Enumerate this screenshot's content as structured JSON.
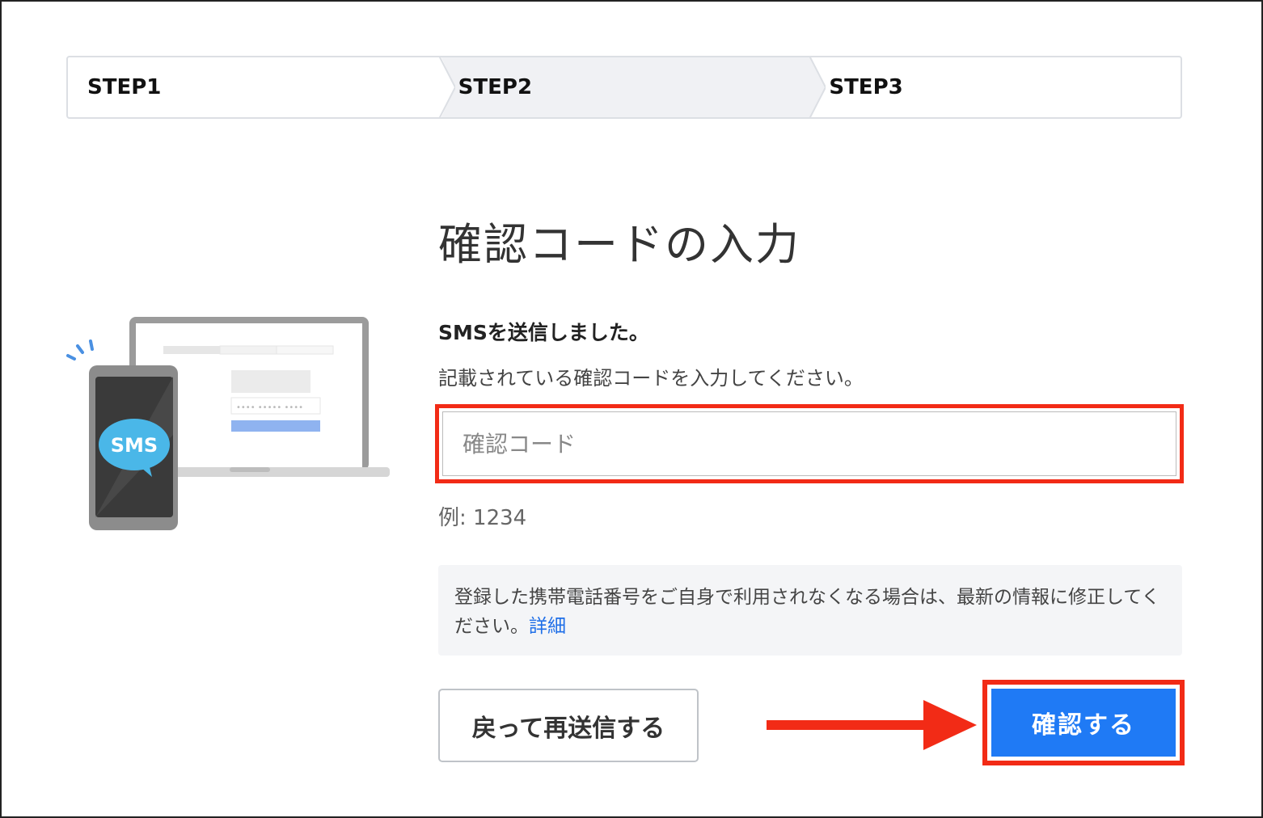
{
  "steps": [
    {
      "label": "STEP1"
    },
    {
      "label": "STEP2"
    },
    {
      "label": "STEP3"
    }
  ],
  "page": {
    "title": "確認コードの入力",
    "lead": "SMSを送信しました。",
    "description": "記載されている確認コードを入力してください。"
  },
  "illustration": {
    "bubble_text": "SMS",
    "field_dots": "•••• ••••• ••••"
  },
  "form": {
    "code_placeholder": "確認コード",
    "code_value": "",
    "example": "例: 1234"
  },
  "note": {
    "text": "登録した携帯電話番号をご自身で利用されなくなる場合は、最新の情報に修正してください。",
    "link": "詳細"
  },
  "buttons": {
    "back_label": "戻って再送信する",
    "confirm_label": "確認する"
  },
  "colors": {
    "accent": "#1f7af5",
    "highlight": "#f22b16",
    "sms_bubble": "#4ab7e8"
  }
}
